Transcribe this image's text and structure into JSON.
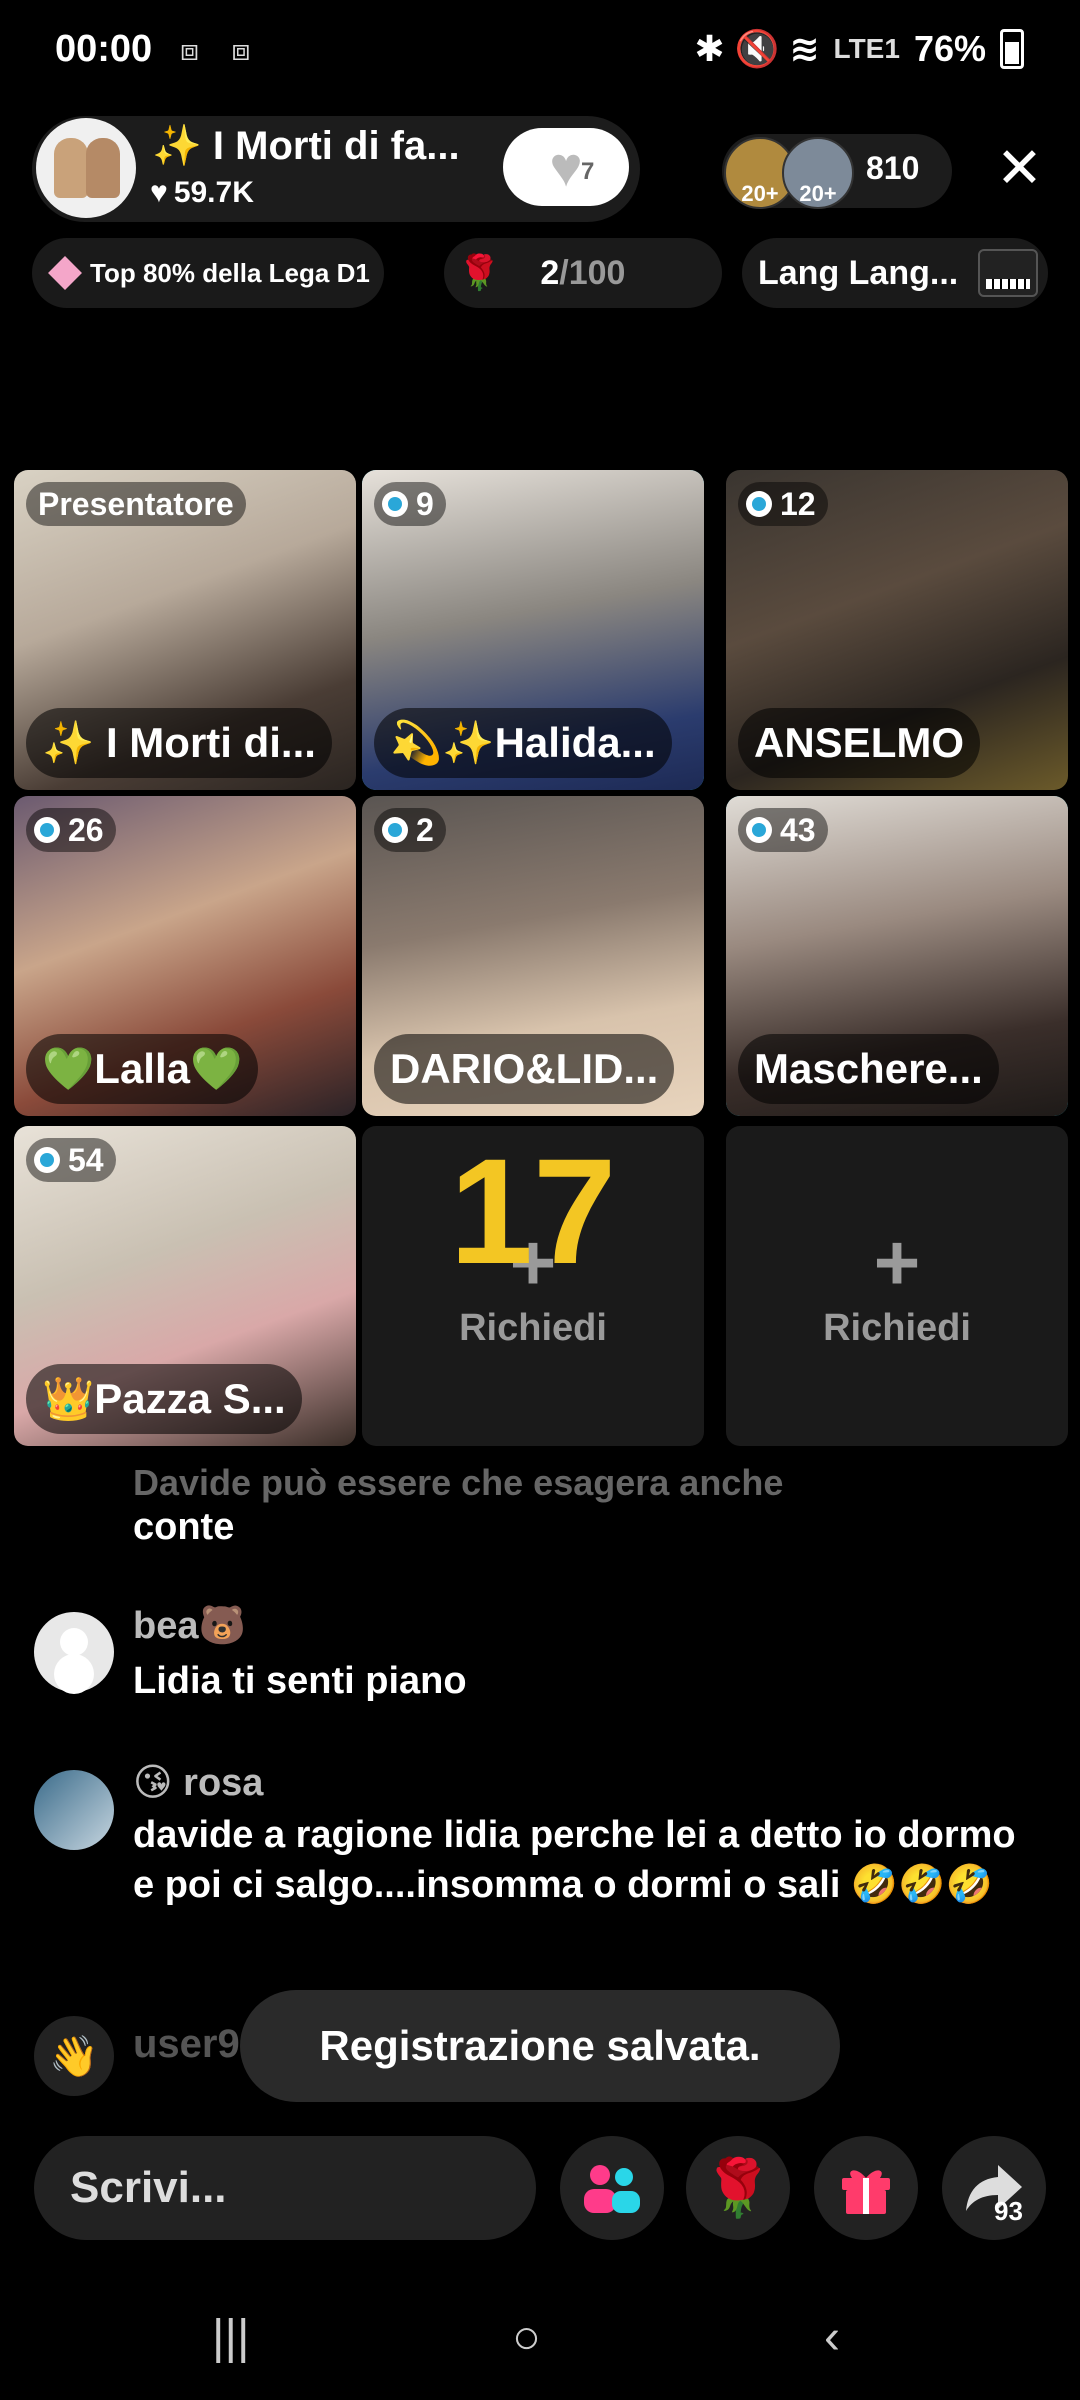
{
  "status_bar": {
    "time": "00:00",
    "left_icons": "⧈ ⧈",
    "right_icons": "✱ 🔇 ≋",
    "network": "LTE1",
    "battery": "76%"
  },
  "header": {
    "host_name": "✨ I Morti di fa...",
    "host_likes": "59.7K",
    "follow_count": "7",
    "viewer_badge_1": "20+",
    "viewer_badge_2": "20+",
    "viewer_count": "810",
    "close_label": "✕"
  },
  "chips": {
    "league": "Top 80% della Lega D1",
    "rose_current": "2",
    "rose_max": "/100",
    "song": "Lang Lang..."
  },
  "grid": {
    "presenter_label": "Presentatore",
    "tiles": [
      {
        "name": "✨ I Morti di..."
      },
      {
        "score": "9",
        "name": "💫✨Halida..."
      },
      {
        "score": "12",
        "name": "ANSELMO"
      },
      {
        "score": "26",
        "name": "💚Lalla💚"
      },
      {
        "score": "2",
        "name": "DARIO&LID..."
      },
      {
        "score": "43",
        "name": "Maschere..."
      },
      {
        "score": "54",
        "name": "👑Pazza S..."
      }
    ],
    "countdown": "17",
    "request_label": "Richiedi"
  },
  "chat": {
    "faded_line": "Davide può essere che esagera anche",
    "line_continuation": "conte",
    "messages": [
      {
        "user": "bea🐻",
        "text": "Lidia ti  senti piano"
      },
      {
        "user": "😘 rosa",
        "text": "davide a ragione lidia perche lei a detto io dormo e poi ci salgo....insomma o dormi o sali 🤣🤣🤣"
      }
    ],
    "join_text": "user96... partecipa"
  },
  "toast": "Registrazione salvata.",
  "bottom": {
    "compose_placeholder": "Scrivi...",
    "share_count": "93"
  },
  "nav": {
    "recents": "|||",
    "home": "○",
    "back": "‹"
  }
}
